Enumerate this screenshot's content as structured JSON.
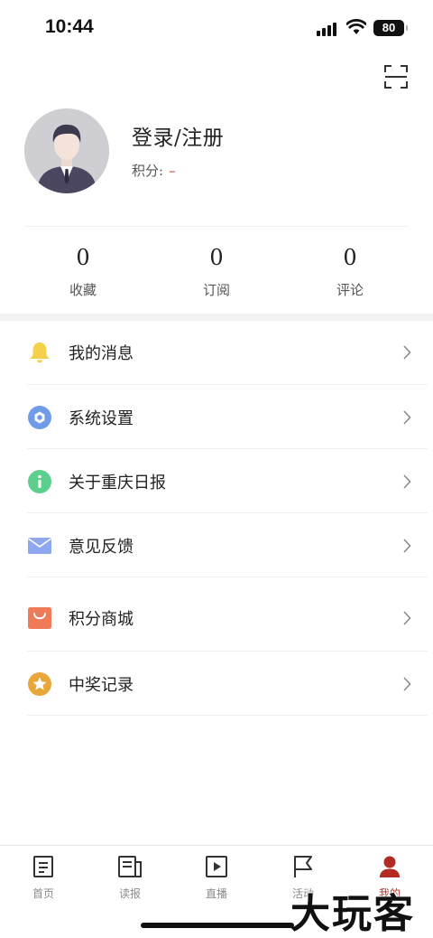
{
  "status_bar": {
    "time": "10:44",
    "battery": "80"
  },
  "profile": {
    "login_label": "登录/注册",
    "points_label": "积分:",
    "points_value": "–"
  },
  "stats": [
    {
      "value": "0",
      "label": "收藏"
    },
    {
      "value": "0",
      "label": "订阅"
    },
    {
      "value": "0",
      "label": "评论"
    }
  ],
  "menu": [
    {
      "label": "我的消息",
      "icon": "bell-icon",
      "color": "#f5d04a"
    },
    {
      "label": "系统设置",
      "icon": "settings-icon",
      "color": "#6f9be8"
    },
    {
      "label": "关于重庆日报",
      "icon": "info-icon",
      "color": "#5ccf8d"
    },
    {
      "label": "意见反馈",
      "icon": "mail-icon",
      "color": "#8fa7f0"
    },
    {
      "label": "积分商城",
      "icon": "shopping-bag-icon",
      "color": "#ef7a58"
    },
    {
      "label": "中奖记录",
      "icon": "star-badge-icon",
      "color": "#e8a73a"
    }
  ],
  "tabs": [
    {
      "label": "首页",
      "icon": "news-icon",
      "active": false
    },
    {
      "label": "读报",
      "icon": "newspaper-icon",
      "active": false
    },
    {
      "label": "直播",
      "icon": "play-icon",
      "active": false
    },
    {
      "label": "活动",
      "icon": "flag-icon",
      "active": false
    },
    {
      "label": "我的",
      "icon": "person-icon",
      "active": true
    }
  ],
  "accent_color": "#b32a23",
  "watermark": "大玩客"
}
